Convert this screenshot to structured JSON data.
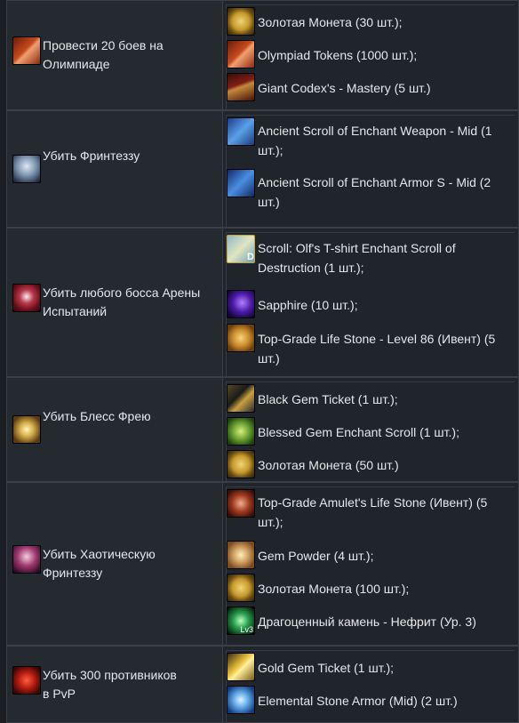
{
  "rows": [
    {
      "task": {
        "label": "Провести 20 боев на Олимпиаде",
        "icon": "olympiad-token-icon"
      },
      "rewards": [
        {
          "label": "Золотая Монета (30 шт.);",
          "icon": "gold-coin-icon"
        },
        {
          "label": "Olympiad Tokens (1000 шт.);",
          "icon": "olympiad-token-icon"
        },
        {
          "label": "Giant Codex's - Mastery (5 шт.)",
          "icon": "codex-book-icon"
        }
      ]
    },
    {
      "task": {
        "label": "Убить Фринтеззу",
        "icon": "frintezza-icon"
      },
      "rewards": [
        {
          "label": "Ancient Scroll of Enchant Weapon - Mid (1 шт.);",
          "icon": "enchant-weapon-scroll-icon"
        },
        {
          "label": "Ancient Scroll of Enchant Armor S - Mid (2 шт.)",
          "icon": "enchant-armor-scroll-icon"
        }
      ]
    },
    {
      "task": {
        "label": "Убить любого босса Арены Испытаний",
        "icon": "arena-boss-icon"
      },
      "rewards": [
        {
          "label": "Scroll: Olf's T-shirt Enchant Scroll of Destruction (1 шт.);",
          "icon": "tshirt-scroll-icon",
          "badge": "D"
        },
        {
          "label": "Sapphire (10 шт.);",
          "icon": "sapphire-icon"
        },
        {
          "label": "Top-Grade Life Stone - Level 86 (Ивент) (5 шт.)",
          "icon": "life-stone-icon"
        }
      ]
    },
    {
      "task": {
        "label": "Убить Блесс Фрею",
        "icon": "freya-snowflake-icon"
      },
      "rewards": [
        {
          "label": "Black Gem Ticket (1 шт.);",
          "icon": "black-ticket-icon"
        },
        {
          "label": "Blessed Gem Enchant Scroll (1 шт.);",
          "icon": "gem-scroll-icon"
        },
        {
          "label": "Золотая Монета (50 шт.)",
          "icon": "gold-coin-icon"
        }
      ]
    },
    {
      "task": {
        "label": "Убить Хаотическую Фринтеззу",
        "icon": "chaotic-frintezza-icon"
      },
      "rewards": [
        {
          "label": "Top-Grade Amulet's Life Stone (Ивент) (5 шт.);",
          "icon": "amulet-stone-icon"
        },
        {
          "label": "Gem Powder (4 шт.);",
          "icon": "gem-powder-icon"
        },
        {
          "label": "Золотая Монета (100 шт.);",
          "icon": "gold-coin-icon"
        },
        {
          "label": "Драгоценный камень - Нефрит (Ур. 3)",
          "icon": "jade-gem-icon",
          "badge": "Lv3"
        }
      ]
    },
    {
      "task": {
        "label": "Убить 300 противников в PvP",
        "icon": "pvp-icon"
      },
      "rewards": [
        {
          "label": "Gold Gem Ticket (1 шт.);",
          "icon": "gold-ticket-icon"
        },
        {
          "label": "Elemental Stone Armor (Mid) (2 шт.)",
          "icon": "elemental-stone-icon"
        }
      ]
    }
  ]
}
